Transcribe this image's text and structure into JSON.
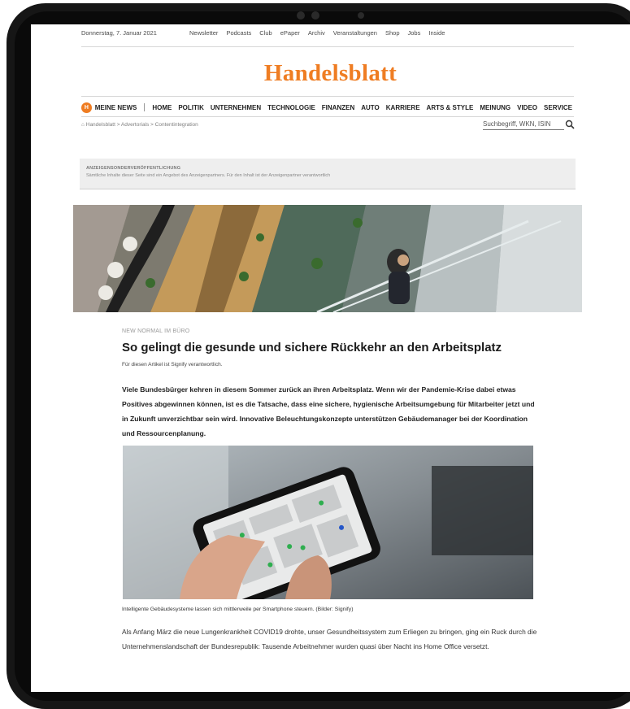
{
  "topbar": {
    "date": "Donnerstag, 7. Januar 2021",
    "links": [
      "Newsletter",
      "Podcasts",
      "Club",
      "ePaper",
      "Archiv",
      "Veranstaltungen",
      "Shop",
      "Jobs",
      "Inside"
    ]
  },
  "logo": "Handelsblatt",
  "nav": {
    "badge": "H",
    "meine_news": "MEINE NEWS",
    "items": [
      "HOME",
      "POLITIK",
      "UNTERNEHMEN",
      "TECHNOLOGIE",
      "FINANZEN",
      "AUTO",
      "KARRIERE",
      "ARTS & STYLE",
      "MEINUNG",
      "VIDEO",
      "SERVICE"
    ]
  },
  "breadcrumb": "Handelsblatt > Advertorials > Contentintegration",
  "search": {
    "placeholder": "Suchbegriff, WKN, ISIN"
  },
  "ad_notice": {
    "title": "ANZEIGENSONDERVERÖFFENTLICHUNG",
    "text": "Sämtliche Inhalte dieser Seite sind ein Angebot des Anzeigenpartners. Für den Inhalt ist der Anzeigenpartner verantwortlich"
  },
  "article": {
    "kicker": "NEW NORMAL IM BÜRO",
    "headline": "So gelingt die gesunde und sichere Rückkehr an den Arbeitsplatz",
    "byline": "Für diesen Artikel ist Signify verantwortlich.",
    "lead": "Viele Bundesbürger kehren in diesem Sommer zurück an ihren Arbeitsplatz. Wenn wir der Pandemie-Krise dabei etwas Positives abgewinnen können, ist es die Tatsache, dass eine sichere, hygienische Arbeitsumgebung für Mitarbeiter jetzt und in Zukunft unverzichtbar sein wird. Innovative Beleuchtungskonzepte unterstützen Gebäudemanager bei der Koordination und Ressourcenplanung.",
    "caption": "Intelligente Gebäudesysteme lassen sich mittlerweile per Smartphone steuern. (Bilder: Signify)",
    "body": "Als Anfang März die neue Lungenkrankheit COVID19 drohte, unser Gesundheitssystem zum Erliegen zu bringen, ging ein Ruck durch die Unternehmenslandschaft der Bundesrepublik: Tausende Arbeitnehmer wurden quasi über Nacht ins Home Office versetzt."
  },
  "colors": {
    "brand": "#ef7d23",
    "frame": "#161616"
  }
}
